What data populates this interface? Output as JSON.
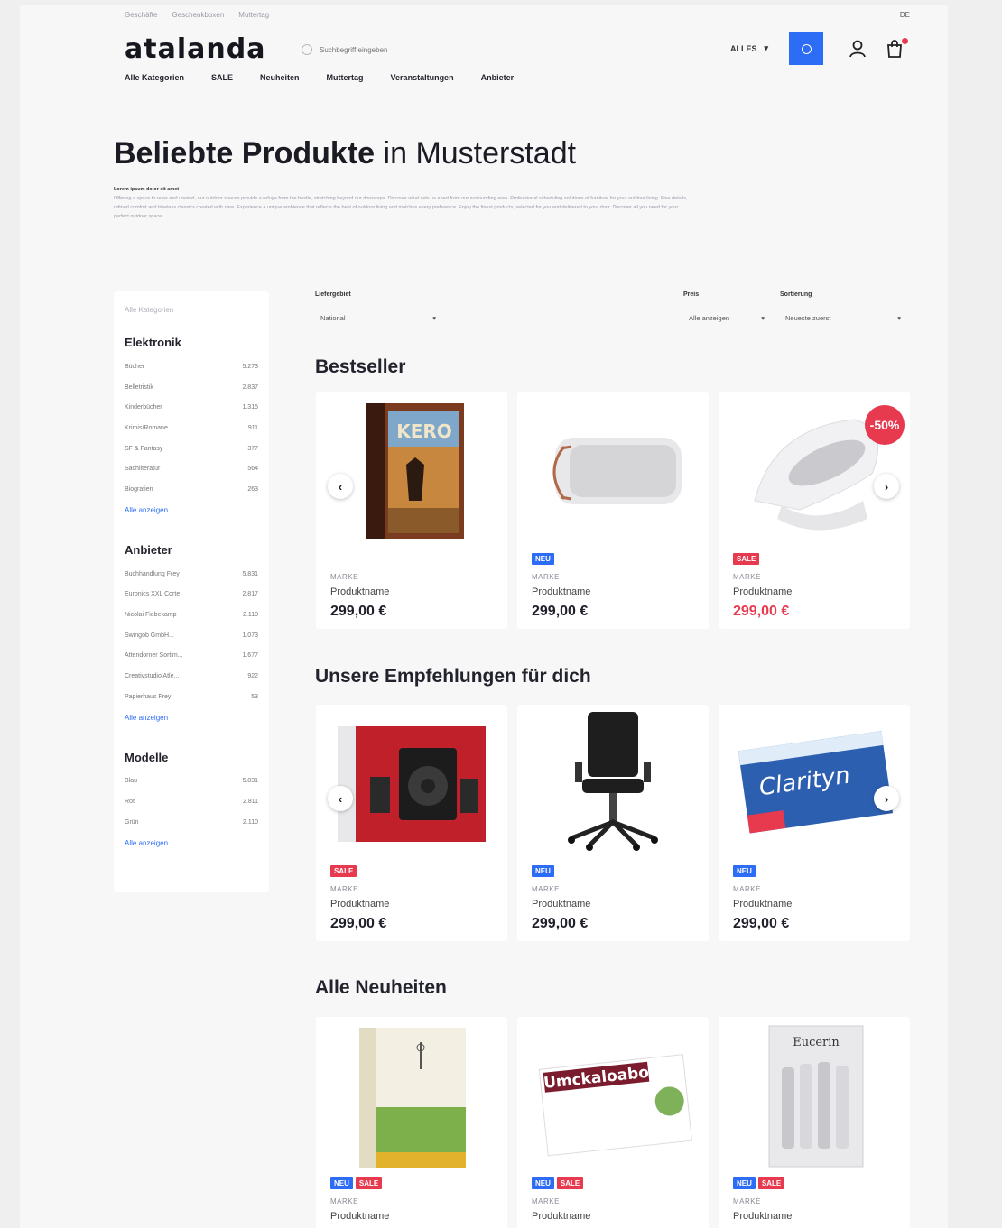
{
  "util_links": [
    "Geschäfte",
    "Geschenkboxen",
    "Muttertag"
  ],
  "language": "DE",
  "logo": "atalanda",
  "search": {
    "placeholder": "Suchbegriff eingeben",
    "scope": "ALLES"
  },
  "nav": [
    "Alle Kategorien",
    "SALE",
    "Neuheiten",
    "Muttertag",
    "Veranstaltungen",
    "Anbieter"
  ],
  "hero": {
    "title_bold": "Beliebte Produkte",
    "title_light": "in Musterstadt",
    "lead": "Lorem ipsum dolor sit amet",
    "text": "Offering a space to relax and unwind, our outdoor spaces provide a refuge from the hustle, stretching beyond our doorsteps. Discover what sets us apart from our surrounding area. Professional scheduling solutions of furniture for your outdoor living. Fine details, refined comfort and timeless classics created with care. Experience a unique ambience that reflects the best of outdoor living and matches every preference. Enjoy the finest products, selected for you and delivered to your door. Discover all you need for your perfect outdoor space."
  },
  "sidebar": {
    "search_placeholder": "Alle Kategorien",
    "groups": [
      {
        "title": "Elektronik",
        "items": [
          {
            "label": "Bücher",
            "count": "5.273"
          },
          {
            "label": "Belletristik",
            "count": "2.837"
          },
          {
            "label": "Kinderbücher",
            "count": "1.315"
          },
          {
            "label": "Krimis/Romane",
            "count": "911"
          },
          {
            "label": "SF & Fantasy",
            "count": "377"
          },
          {
            "label": "Sachliteratur",
            "count": "564"
          },
          {
            "label": "Biografien",
            "count": "263"
          }
        ],
        "more": "Alle anzeigen"
      },
      {
        "title": "Anbieter",
        "items": [
          {
            "label": "Buchhandlung Frey",
            "count": "5.831"
          },
          {
            "label": "Euronics XXL Corte",
            "count": "2.817"
          },
          {
            "label": "Nicolai Fiebekamp",
            "count": "2.110"
          },
          {
            "label": "Swingob GmbH...",
            "count": "1.073"
          },
          {
            "label": "Attendorner Sortim...",
            "count": "1.677"
          },
          {
            "label": "Creativstudio Atle...",
            "count": "922"
          },
          {
            "label": "Papierhaus Frey",
            "count": "53"
          }
        ],
        "more": "Alle anzeigen"
      },
      {
        "title": "Modelle",
        "items": [
          {
            "label": "Blau",
            "count": "5.831"
          },
          {
            "label": "Rot",
            "count": "2.811"
          },
          {
            "label": "Grün",
            "count": "2.110"
          }
        ],
        "more": "Alle anzeigen"
      }
    ]
  },
  "filters": {
    "delivery": {
      "label": "Liefergebiet",
      "value": "National"
    },
    "price": {
      "label": "Preis",
      "value": "Alle anzeigen"
    },
    "sort": {
      "label": "Sortierung",
      "value": "Neueste zuerst"
    }
  },
  "sections": [
    {
      "title": "Bestseller",
      "products": [
        {
          "brand": "MARKE",
          "name": "Produktname",
          "price": "299,00 €",
          "badges": [],
          "image": "board-game-box"
        },
        {
          "brand": "MARKE",
          "name": "Produktname",
          "price": "299,00 €",
          "badges": [
            "NEU"
          ],
          "image": "bluetooth-speaker"
        },
        {
          "brand": "MARKE",
          "name": "Produktname",
          "price": "299,00 €",
          "badges": [
            "SALE"
          ],
          "image": "white-lamp",
          "discount": "-50%"
        }
      ]
    },
    {
      "title": "Unsere Empfehlungen für dich",
      "products": [
        {
          "brand": "MARKE",
          "name": "Produktname",
          "price": "299,00 €",
          "badges": [
            "SALE"
          ],
          "image": "speaker-set-box"
        },
        {
          "brand": "MARKE",
          "name": "Produktname",
          "price": "299,00 €",
          "badges": [
            "NEU"
          ],
          "image": "office-chair"
        },
        {
          "brand": "MARKE",
          "name": "Produktname",
          "price": "299,00 €",
          "badges": [
            "NEU"
          ],
          "image": "clarityn-box"
        }
      ]
    },
    {
      "title": "Alle Neuheiten",
      "products": [
        {
          "brand": "MARKE",
          "name": "Produktname",
          "price": "",
          "badges": [
            "NEU",
            "SALE"
          ],
          "image": "tea-box"
        },
        {
          "brand": "MARKE",
          "name": "Produktname",
          "price": "",
          "badges": [
            "NEU",
            "SALE"
          ],
          "image": "umckaloabo-box"
        },
        {
          "brand": "MARKE",
          "name": "Produktname",
          "price": "",
          "badges": [
            "NEU",
            "SALE"
          ],
          "image": "eucerin-ampoules"
        }
      ]
    }
  ],
  "brand_texts": {
    "kero": "KERO",
    "clarityn": "Clarityn",
    "umckaloabo": "Umckaloabo",
    "eucerin": "Eucerin"
  },
  "colors": {
    "accent": "#2d6cf5",
    "sale": "#e83a4f",
    "text": "#1f1f2b"
  }
}
